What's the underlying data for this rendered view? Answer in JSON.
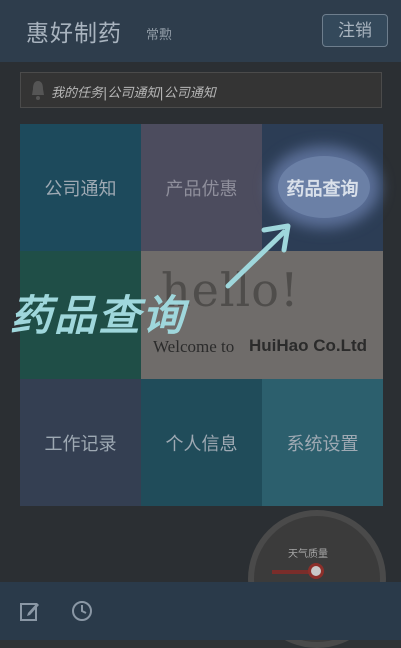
{
  "header": {
    "app_title": "惠好制药",
    "user_name": "常勲",
    "logout_label": "注销"
  },
  "notice_bar": {
    "icon": "bell-icon",
    "text": "我的任务|公司通知|公司通知"
  },
  "tiles": {
    "company_notice": "公司通知",
    "product_promo": "产品优惠",
    "drug_query": "药品查询",
    "work_log": "工作记录",
    "personal_info": "个人信息",
    "system_settings": "系统设置"
  },
  "banner": {
    "hello": "hello!",
    "welcome": "Welcome to",
    "company": "HuiHao Co.Ltd"
  },
  "gauge": {
    "label": "天气质量"
  },
  "guide": {
    "text": "药品查询"
  },
  "bottom_bar": {
    "icons": [
      "edit-icon",
      "clock-icon"
    ]
  },
  "colors": {
    "header_bg": "#2e3d4c",
    "highlight_glow": "#6b80a6",
    "guide_text": "#9fd7dc"
  }
}
